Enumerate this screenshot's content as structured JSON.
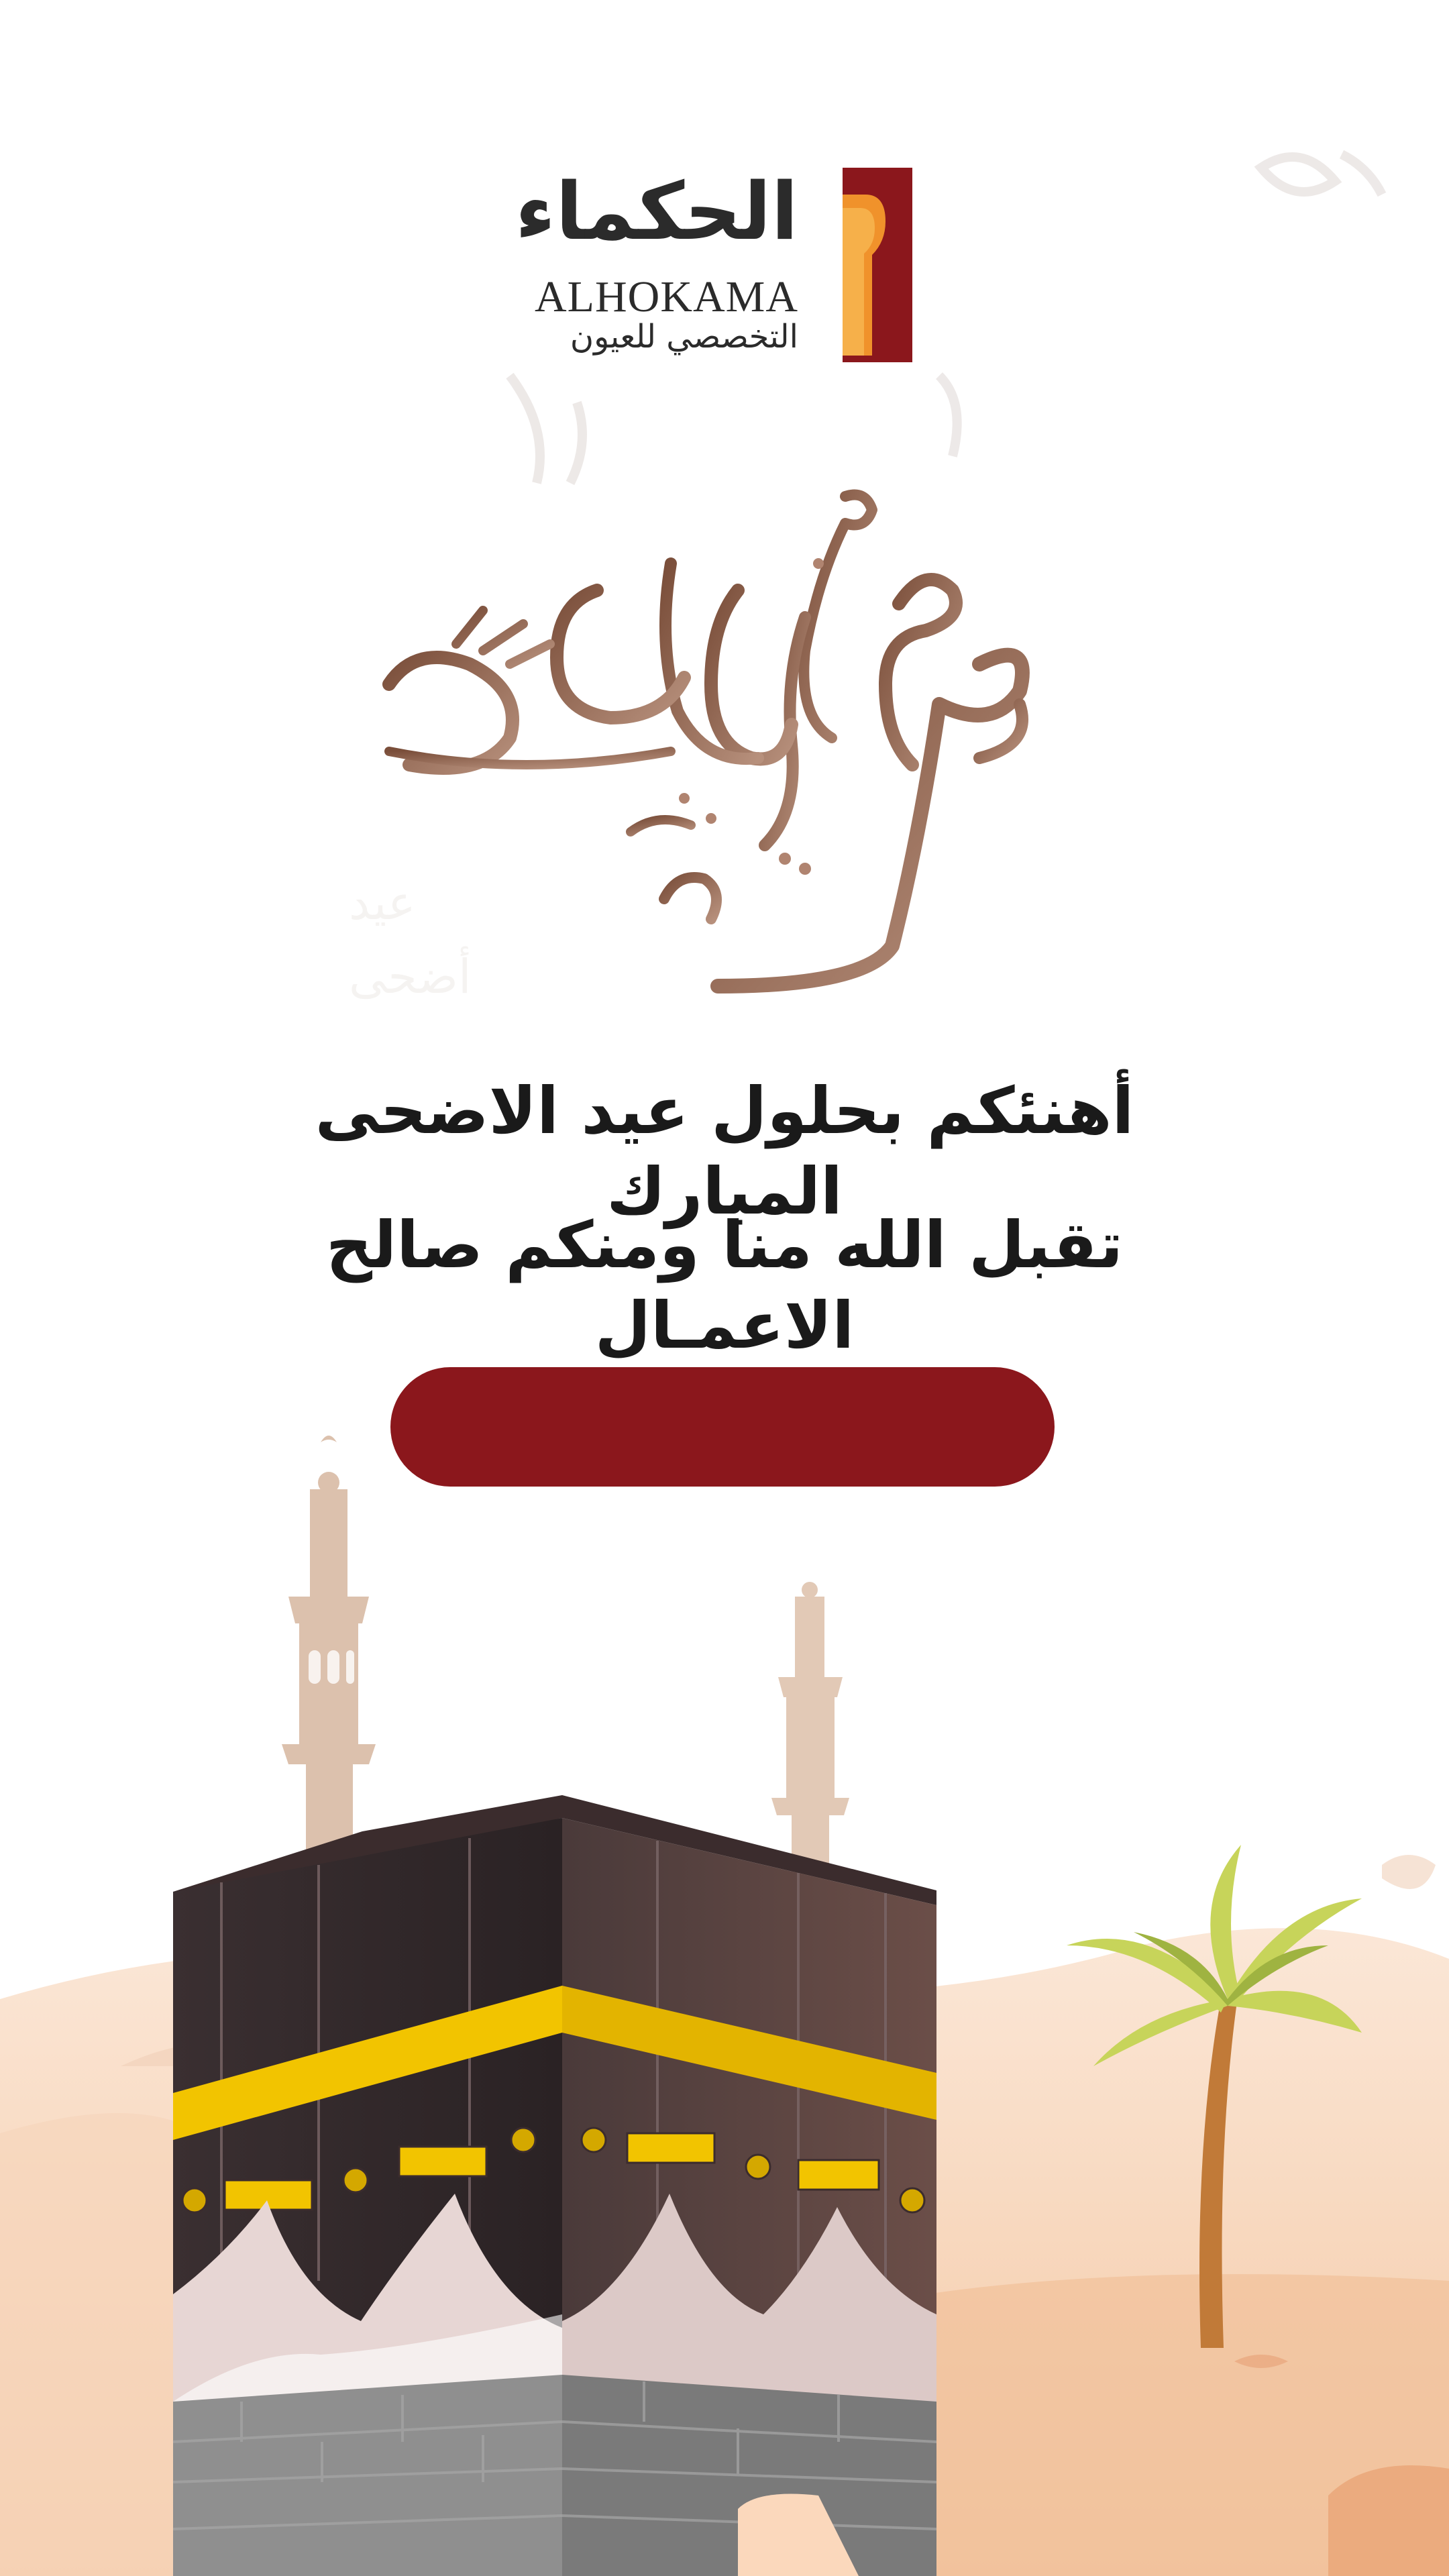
{
  "brand": {
    "name_ar": "الحكماء",
    "name_en": "ALHOKAMA",
    "tagline_ar": "التخصصي للعيون",
    "colors": {
      "maroon": "#8b171c",
      "orange": "#f0922b",
      "dark": "#2b2b2b"
    }
  },
  "calligraphy": {
    "text": "عيد أضحى مبارك",
    "color": "#8f6147"
  },
  "greeting": {
    "line1": "أهنئكم بحلول عيد الاضحى المبارك",
    "line2": "تقبل الله منا ومنكم صالح الاعمـال"
  },
  "cta_button": {
    "label": "",
    "color": "#8b171c"
  },
  "illustration": {
    "subject": "kaaba-with-minarets-and-palm",
    "icons": [
      "kaaba-icon",
      "minaret-icon",
      "palm-tree-icon",
      "sand-dune-icon"
    ]
  }
}
